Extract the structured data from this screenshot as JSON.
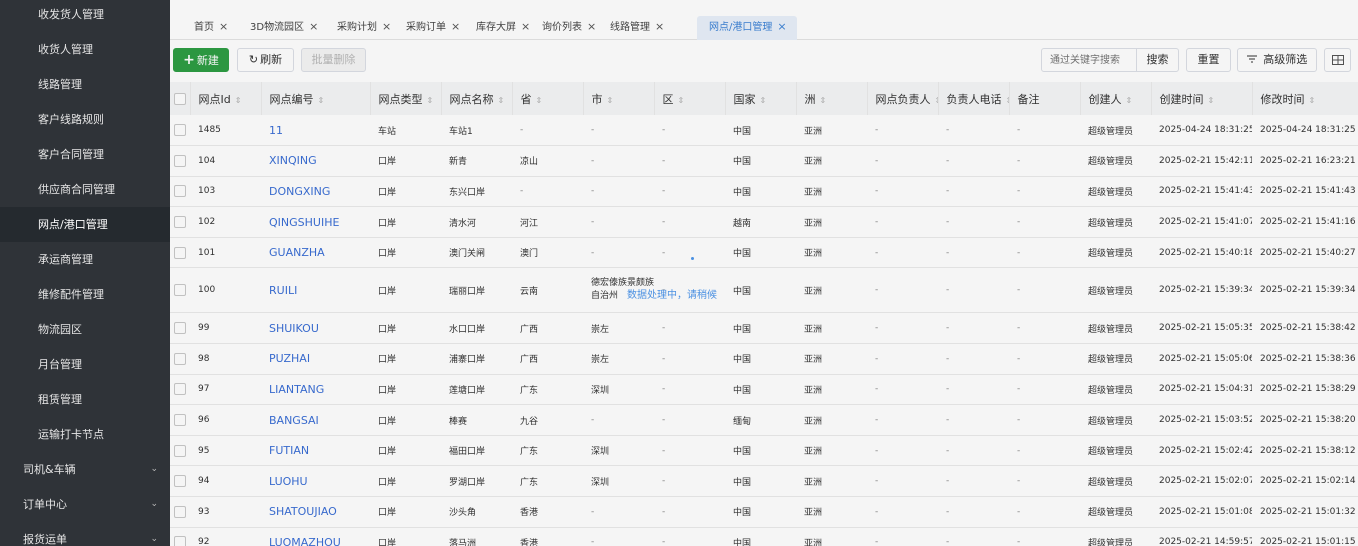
{
  "sidebar": {
    "items": [
      {
        "label": "收发货人管理"
      },
      {
        "label": "收货人管理"
      },
      {
        "label": "线路管理"
      },
      {
        "label": "客户线路规则"
      },
      {
        "label": "客户合同管理"
      },
      {
        "label": "供应商合同管理"
      },
      {
        "label": "网点/港口管理",
        "active": true
      },
      {
        "label": "承运商管理"
      },
      {
        "label": "维修配件管理"
      },
      {
        "label": "物流园区"
      },
      {
        "label": "月台管理"
      },
      {
        "label": "租赁管理"
      },
      {
        "label": "运输打卡节点"
      }
    ],
    "groups": [
      {
        "label": "司机&车辆"
      },
      {
        "label": "订单中心"
      },
      {
        "label": "报货运单"
      }
    ]
  },
  "tabs": [
    {
      "label": "首页"
    },
    {
      "label": "3D物流园区"
    },
    {
      "label": "采购计划"
    },
    {
      "label": "采购订单"
    },
    {
      "label": "库存大屏"
    },
    {
      "label": "询价列表"
    },
    {
      "label": "线路管理"
    },
    {
      "label": "网点/港口管理",
      "active": true
    }
  ],
  "tab_close_icon": "×",
  "toolbar": {
    "new_label": "新建",
    "refresh_label": "刷新",
    "batch_delete_label": "批量删除",
    "search_placeholder": "通过关键字搜索",
    "search_label": "搜索",
    "reset_label": "重置",
    "advanced_filter_label": "高级筛选"
  },
  "icons": {
    "plus": "plus-icon",
    "refresh": "refresh-icon",
    "filter": "filter-icon",
    "columns": "columns-icon",
    "sort": "sort-icon",
    "chevron": "chevron-down-icon"
  },
  "colors": {
    "sidebar_bg": "#2f3338",
    "primary_green": "#2e9e44",
    "accent_blue": "#3b82d6",
    "link_blue": "#3b6fd6"
  },
  "table": {
    "columns": [
      "网点Id",
      "网点编号",
      "网点类型",
      "网点名称",
      "省",
      "市",
      "区",
      "国家",
      "洲",
      "网点负责人",
      "负责人电话",
      "备注",
      "创建人",
      "创建时间",
      "修改时间"
    ],
    "rows": [
      [
        "1485",
        "11",
        "车站",
        "车站1",
        "-",
        "-",
        "-",
        "中国",
        "亚洲",
        "-",
        "-",
        "-",
        "超级管理员",
        "2025-04-24 18:31:25",
        "2025-04-24 18:31:25"
      ],
      [
        "104",
        "XINQING",
        "口岸",
        "新青",
        "凉山",
        "-",
        "-",
        "中国",
        "亚洲",
        "-",
        "-",
        "-",
        "超级管理员",
        "2025-02-21 15:42:11",
        "2025-02-21 16:23:21"
      ],
      [
        "103",
        "DONGXING",
        "口岸",
        "东兴口岸",
        "-",
        "-",
        "-",
        "中国",
        "亚洲",
        "-",
        "-",
        "-",
        "超级管理员",
        "2025-02-21 15:41:43",
        "2025-02-21 15:41:43"
      ],
      [
        "102",
        "QINGSHUIHE",
        "口岸",
        "清水河",
        "河江",
        "-",
        "-",
        "越南",
        "亚洲",
        "-",
        "-",
        "-",
        "超级管理员",
        "2025-02-21 15:41:07",
        "2025-02-21 15:41:16"
      ],
      [
        "101",
        "GUANZHA",
        "口岸",
        "澳门关闸",
        "澳门",
        "-",
        "-",
        "中国",
        "亚洲",
        "-",
        "-",
        "-",
        "超级管理员",
        "2025-02-21 15:40:18",
        "2025-02-21 15:40:27"
      ],
      [
        "100",
        "RUILI",
        "口岸",
        "瑞丽口岸",
        "云南",
        "德宏傣族景颇族自治州",
        "-",
        "中国",
        "亚洲",
        "-",
        "-",
        "-",
        "超级管理员",
        "2025-02-21 15:39:34",
        "2025-02-21 15:39:34"
      ],
      [
        "99",
        "SHUIKOU",
        "口岸",
        "水口口岸",
        "广西",
        "崇左",
        "-",
        "中国",
        "亚洲",
        "-",
        "-",
        "-",
        "超级管理员",
        "2025-02-21 15:05:35",
        "2025-02-21 15:38:42"
      ],
      [
        "98",
        "PUZHAI",
        "口岸",
        "浦寨口岸",
        "广西",
        "崇左",
        "-",
        "中国",
        "亚洲",
        "-",
        "-",
        "-",
        "超级管理员",
        "2025-02-21 15:05:06",
        "2025-02-21 15:38:36"
      ],
      [
        "97",
        "LIANTANG",
        "口岸",
        "莲塘口岸",
        "广东",
        "深圳",
        "-",
        "中国",
        "亚洲",
        "-",
        "-",
        "-",
        "超级管理员",
        "2025-02-21 15:04:31",
        "2025-02-21 15:38:29"
      ],
      [
        "96",
        "BANGSAI",
        "口岸",
        "棒赛",
        "九谷",
        "-",
        "-",
        "缅甸",
        "亚洲",
        "-",
        "-",
        "-",
        "超级管理员",
        "2025-02-21 15:03:52",
        "2025-02-21 15:38:20"
      ],
      [
        "95",
        "FUTIAN",
        "口岸",
        "福田口岸",
        "广东",
        "深圳",
        "-",
        "中国",
        "亚洲",
        "-",
        "-",
        "-",
        "超级管理员",
        "2025-02-21 15:02:42",
        "2025-02-21 15:38:12"
      ],
      [
        "94",
        "LUOHU",
        "口岸",
        "罗湖口岸",
        "广东",
        "深圳",
        "-",
        "中国",
        "亚洲",
        "-",
        "-",
        "-",
        "超级管理员",
        "2025-02-21 15:02:07",
        "2025-02-21 15:02:14"
      ],
      [
        "93",
        "SHATOUJIAO",
        "口岸",
        "沙头角",
        "香港",
        "-",
        "-",
        "中国",
        "亚洲",
        "-",
        "-",
        "-",
        "超级管理员",
        "2025-02-21 15:01:08",
        "2025-02-21 15:01:32"
      ],
      [
        "92",
        "LUOMAZHOU",
        "口岸",
        "落马洲",
        "香港",
        "-",
        "-",
        "中国",
        "亚洲",
        "-",
        "-",
        "-",
        "超级管理员",
        "2025-02-21 14:59:57",
        "2025-02-21 15:01:15"
      ]
    ]
  },
  "loading": {
    "text": "数据处理中，请稍候"
  }
}
